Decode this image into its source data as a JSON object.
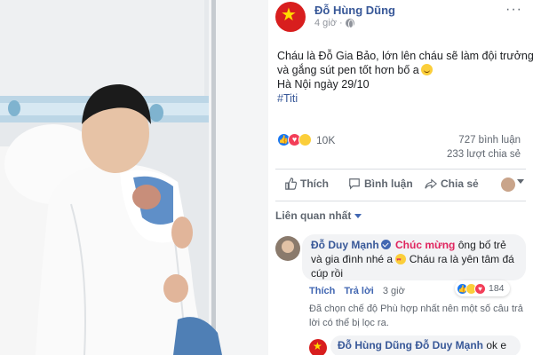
{
  "post": {
    "author_name": "Đỗ Hùng Dũng",
    "time": "4 giờ",
    "text_lines": [
      "Cháu là Đỗ Gia Bảo, lớn lên cháu sẽ làm đội trưởng",
      "và gắng sút pen tốt hơn bố a",
      "Hà Nội ngày 29/10",
      "#Titi"
    ],
    "reaction_count": "10K",
    "comment_count": "727 bình luận",
    "share_count": "233 lượt chia sẻ",
    "actions": {
      "like": "Thích",
      "comment": "Bình luận",
      "share": "Chia sẻ"
    }
  },
  "comments_filter": "Liên quan nhất",
  "comment": {
    "author_name": "Đỗ Duy Mạnh",
    "highlight": "Chúc mừng",
    "text_1": "ông bố trẻ",
    "text_2": "và gia đình nhé a",
    "text_3": "Cháu ra là yên tâm đá",
    "text_4": "cúp rồi",
    "like_label": "Thích",
    "reply_label": "Trả lời",
    "time": "3 giờ",
    "reaction_count": "184"
  },
  "notice": "Đã chọn chế độ Phù hợp nhất nên một số câu trả lời có thể bị lọc ra.",
  "reply": {
    "author_name": "Đỗ Hùng Dũng",
    "mention": "Đỗ Duy Mạnh",
    "text": "ok e"
  },
  "icons": {
    "author_avatar": "vietnam-flag-avatar",
    "privacy": "globe-icon",
    "more": "more-icon",
    "like": "thumbs-up-icon",
    "comment": "comment-icon",
    "share": "share-icon"
  },
  "colors": {
    "link": "#385898",
    "accent": "#4267b2",
    "secondary_text": "#606770",
    "bubble": "#f2f3f5",
    "like": "#1877f2",
    "love": "#f33e58",
    "haha": "#fbce3a"
  }
}
